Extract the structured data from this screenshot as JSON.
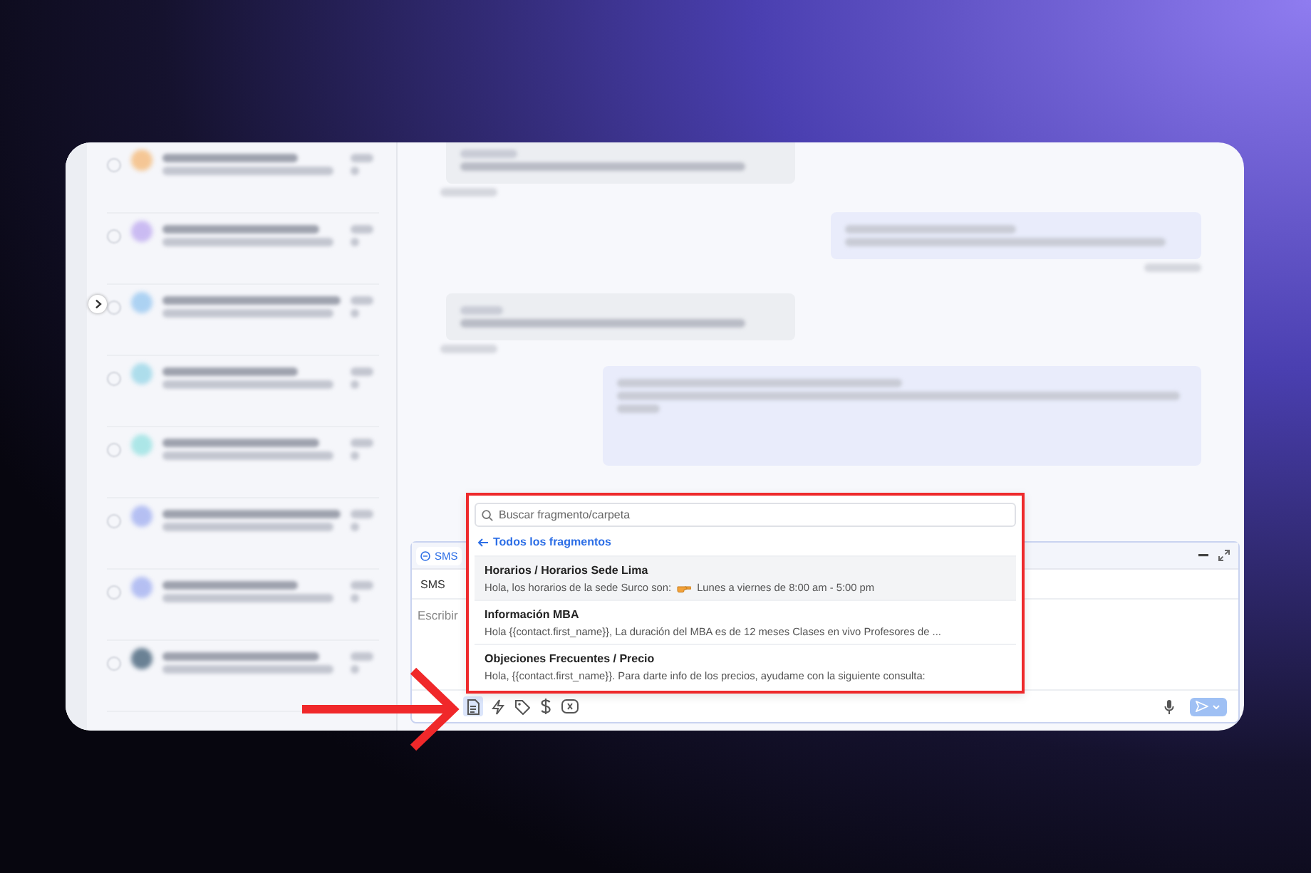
{
  "composer": {
    "tabs": [
      {
        "label": "SMS",
        "selected": true
      }
    ],
    "channel": "SMS",
    "placeholder": "Escribir",
    "toolbar": [
      {
        "kind": "snippet",
        "selected": true
      },
      {
        "kind": "bolt",
        "selected": false
      },
      {
        "kind": "tag",
        "selected": false
      },
      {
        "kind": "dollar",
        "selected": false
      },
      {
        "kind": "clear",
        "selected": false
      }
    ]
  },
  "snippet_popup": {
    "search_placeholder": "Buscar fragmento/carpeta",
    "back_link": "Todos los fragmentos",
    "items": [
      {
        "title": "Horarios / Horarios Sede Lima",
        "preview": "Hola, los horarios de la sede Surco son:",
        "preview_after": "Lunes a viernes de 8:00 am - 5:00 pm",
        "selected": true
      },
      {
        "title": "Información MBA",
        "preview": "Hola {{contact.first_name}}, La duración del MBA es de 12 meses Clases en vivo Profesores de ...",
        "selected": false
      },
      {
        "title": "Objeciones Frecuentes / Precio",
        "preview": "Hola, {{contact.first_name}}. Para darte info de los precios, ayudame con la siguiente consulta:",
        "selected": false
      }
    ]
  }
}
